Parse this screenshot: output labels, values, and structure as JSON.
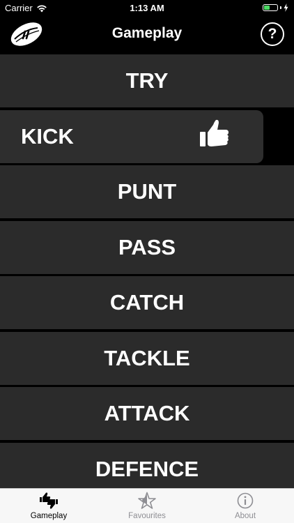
{
  "status_bar": {
    "carrier": "Carrier",
    "time": "1:13 AM",
    "battery_level": 0.45,
    "battery_color": "#4cd964"
  },
  "nav": {
    "title": "Gameplay",
    "help_label": "?",
    "logo_icon": "rugby-ball-logo-icon",
    "help_icon": "question-circle-icon"
  },
  "list": {
    "items": [
      {
        "label": "TRY"
      },
      {
        "label": "KICK",
        "action_icon": "thumbs-up-icon"
      },
      {
        "label": "PUNT"
      },
      {
        "label": "PASS"
      },
      {
        "label": "CATCH"
      },
      {
        "label": "TACKLE"
      },
      {
        "label": "ATTACK"
      },
      {
        "label": "DEFENCE"
      }
    ]
  },
  "tab_bar": {
    "active_color": "#000000",
    "inactive_color": "#8e8e93",
    "tabs": [
      {
        "label": "Gameplay",
        "icon": "thumbs-up-down-icon",
        "active": true
      },
      {
        "label": "Favourites",
        "icon": "star-icon",
        "active": false
      },
      {
        "label": "About",
        "icon": "info-icon",
        "active": false
      }
    ]
  }
}
